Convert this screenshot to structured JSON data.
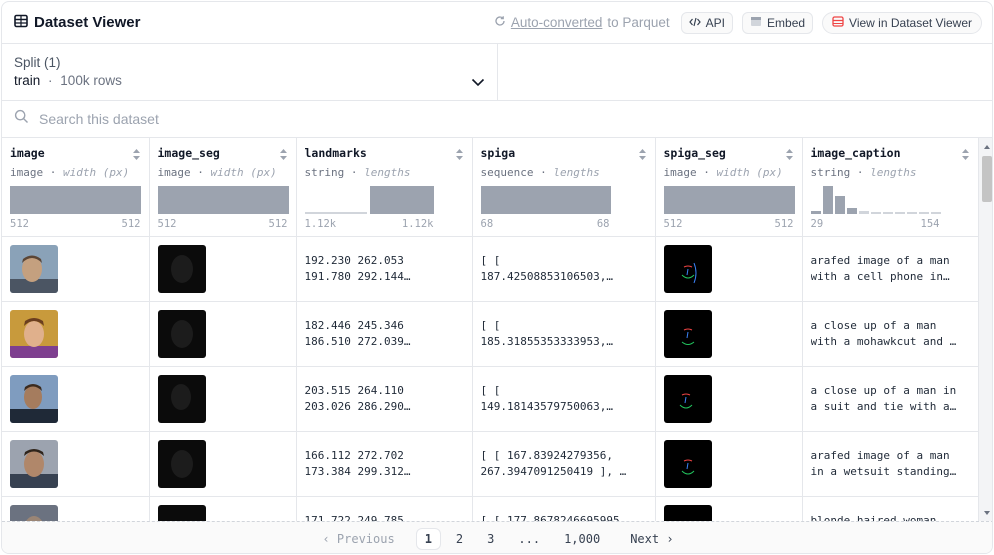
{
  "header": {
    "title": "Dataset Viewer",
    "auto_converted": "Auto-converted",
    "to_parquet": "to Parquet",
    "api_label": "API",
    "embed_label": "Embed",
    "view_label": "View in Dataset Viewer"
  },
  "split": {
    "label": "Split (1)",
    "name": "train",
    "separator": "·",
    "rows": "100k rows"
  },
  "search": {
    "placeholder": "Search this dataset"
  },
  "columns": [
    {
      "name": "image",
      "type": "image",
      "meta": "width (px)",
      "min": "512",
      "max": "512"
    },
    {
      "name": "image_seg",
      "type": "image",
      "meta": "width (px)",
      "min": "512",
      "max": "512"
    },
    {
      "name": "landmarks",
      "type": "string",
      "meta": "lengths",
      "min": "1.12k",
      "max": "1.12k"
    },
    {
      "name": "spiga",
      "type": "sequence",
      "meta": "lengths",
      "min": "68",
      "max": "68"
    },
    {
      "name": "spiga_seg",
      "type": "image",
      "meta": "width (px)",
      "min": "512",
      "max": "512"
    },
    {
      "name": "image_caption",
      "type": "string",
      "meta": "lengths",
      "min": "29",
      "max": "154"
    }
  ],
  "rows": [
    {
      "landmarks": [
        "192.230 262.053",
        "191.780 292.144…"
      ],
      "spiga": [
        "[ [",
        "187.42508853106503,…"
      ],
      "caption": [
        "arafed image of a man",
        "with a cell phone in…"
      ]
    },
    {
      "landmarks": [
        "182.446 245.346",
        "186.510 272.039…"
      ],
      "spiga": [
        "[ [",
        "185.31855353333953,…"
      ],
      "caption": [
        "a close up of a man",
        "with a mohawkcut and …"
      ]
    },
    {
      "landmarks": [
        "203.515 264.110",
        "203.026 286.290…"
      ],
      "spiga": [
        "[ [",
        "149.18143579750063,…"
      ],
      "caption": [
        "a close up of a man in",
        "a suit and tie with a…"
      ]
    },
    {
      "landmarks": [
        "166.112 272.702",
        "173.384 299.312…"
      ],
      "spiga": [
        "[ [ 167.83924279356,",
        "267.3947091250419 ], …"
      ],
      "caption": [
        "arafed image of a man",
        "in a wetsuit standing…"
      ]
    },
    {
      "landmarks": [
        "171.722 249.785",
        ""
      ],
      "spiga": [
        "[ [ 177.8678246695995",
        ""
      ],
      "caption": [
        "blonde haired woman",
        ""
      ]
    }
  ],
  "pagination": {
    "previous": "Previous",
    "pages": [
      "1",
      "2",
      "3",
      "...",
      "1,000"
    ],
    "next": "Next"
  },
  "colors": {
    "accent": "#ef4444",
    "bar": "#9ca3af"
  }
}
